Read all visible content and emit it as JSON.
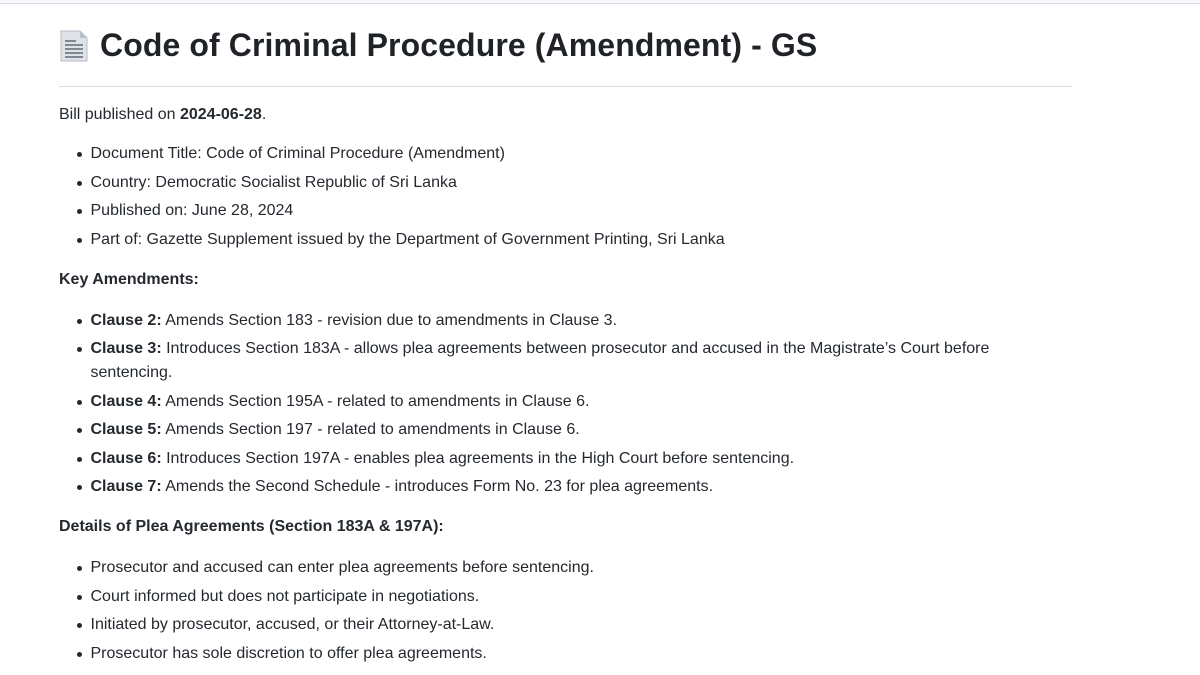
{
  "document": {
    "title_icon": "page-facing-up-icon",
    "title": "Code of Criminal Procedure (Amendment) - GS",
    "published_prefix": "Bill published on ",
    "published_date": "2024-06-28",
    "published_suffix": "."
  },
  "info_items": [
    "Document Title: Code of Criminal Procedure (Amendment)",
    "Country: Democratic Socialist Republic of Sri Lanka",
    "Published on: June 28, 2024",
    "Part of: Gazette Supplement issued by the Department of Government Printing, Sri Lanka"
  ],
  "key_amendments": {
    "heading": "Key Amendments:",
    "items": [
      {
        "clause": "Clause 2:",
        "text": "Amends Section 183 - revision due to amendments in Clause 3."
      },
      {
        "clause": "Clause 3:",
        "text": "Introduces Section 183A - allows plea agreements between prosecutor and accused in the Magistrate’s Court before sentencing."
      },
      {
        "clause": "Clause 4:",
        "text": "Amends Section 195A - related to amendments in Clause 6."
      },
      {
        "clause": "Clause 5:",
        "text": "Amends Section 197 - related to amendments in Clause 6."
      },
      {
        "clause": "Clause 6:",
        "text": "Introduces Section 197A - enables plea agreements in the High Court before sentencing."
      },
      {
        "clause": "Clause 7:",
        "text": "Amends the Second Schedule - introduces Form No. 23 for plea agreements."
      }
    ]
  },
  "plea_details": {
    "heading": "Details of Plea Agreements (Section 183A & 197A):",
    "items": [
      "Prosecutor and accused can enter plea agreements before sentencing.",
      "Court informed but does not participate in negotiations.",
      "Initiated by prosecutor, accused, or their Attorney-at-Law.",
      "Prosecutor has sole discretion to offer plea agreements."
    ]
  }
}
